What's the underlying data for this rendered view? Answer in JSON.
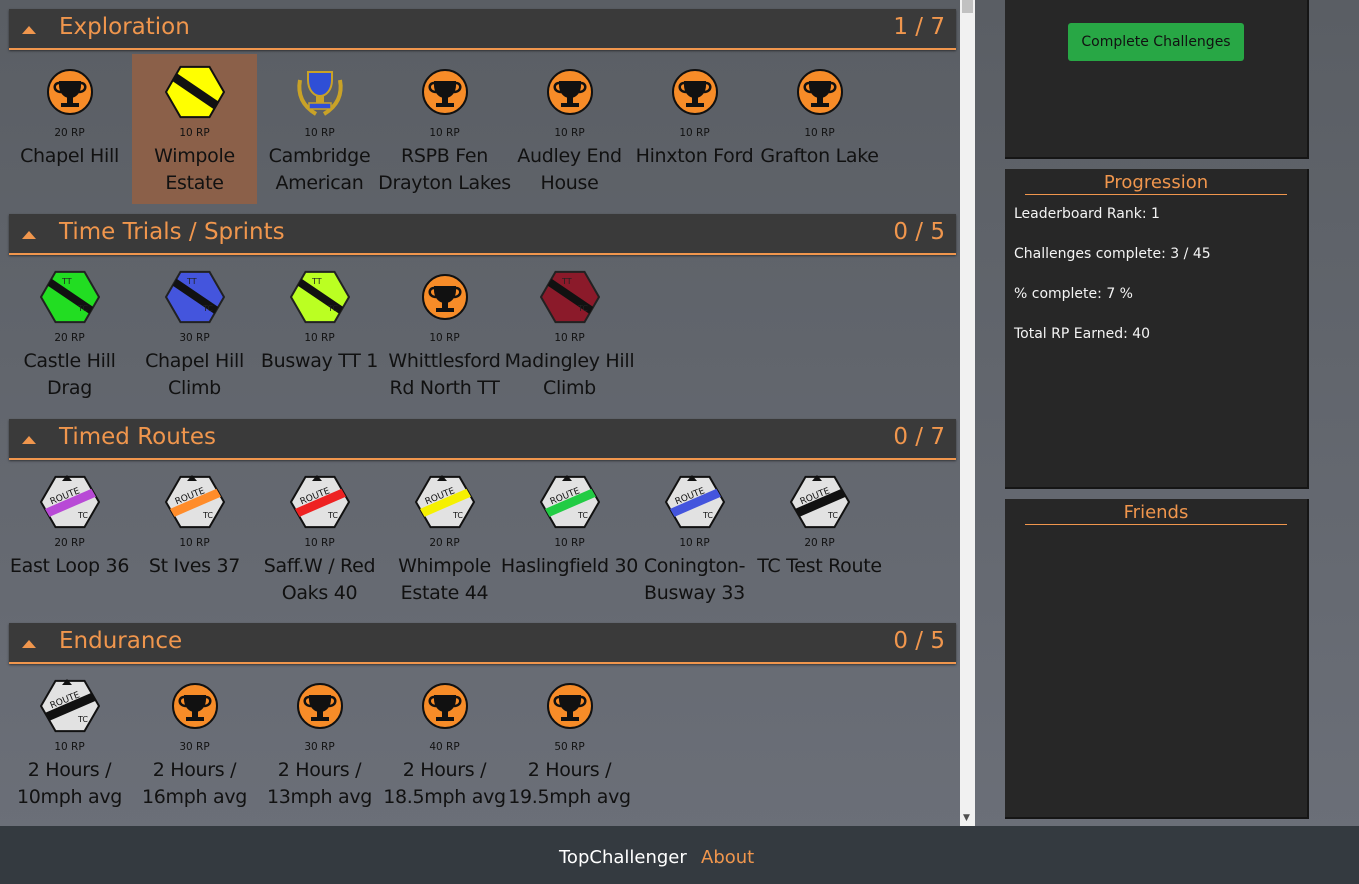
{
  "colors": {
    "accent": "#f0964d",
    "trophy_orange": "#f78c28",
    "button_green": "#28a745",
    "panel_bg": "#272727",
    "header_bg": "#3a3a3a",
    "footer_bg": "#343a40"
  },
  "sections": [
    {
      "title": "Exploration",
      "count": "1 / 7",
      "items": [
        {
          "icon": "trophy-icon",
          "rp": "20 RP",
          "name": "Chapel Hill"
        },
        {
          "icon": "hex-badge-icon",
          "color": "#ffff00",
          "rp": "10 RP",
          "name": "Wimpole Estate",
          "selected": true
        },
        {
          "icon": "gold-trophy-icon",
          "rp": "10 RP",
          "name": "Cambridge American"
        },
        {
          "icon": "trophy-icon",
          "rp": "10 RP",
          "name": "RSPB Fen Drayton Lakes"
        },
        {
          "icon": "trophy-icon",
          "rp": "10 RP",
          "name": "Audley End House"
        },
        {
          "icon": "trophy-icon",
          "rp": "10 RP",
          "name": "Hinxton Ford"
        },
        {
          "icon": "trophy-icon",
          "rp": "10 RP",
          "name": "Grafton Lake"
        }
      ]
    },
    {
      "title": "Time Trials / Sprints",
      "count": "0 / 5",
      "items": [
        {
          "icon": "tt-badge-icon",
          "color": "#22dd22",
          "rp": "20 RP",
          "name": "Castle Hill Drag"
        },
        {
          "icon": "tt-badge-icon",
          "color": "#4455dd",
          "rp": "30 RP",
          "name": "Chapel Hill Climb"
        },
        {
          "icon": "tt-badge-icon",
          "color": "#bbff22",
          "rp": "10 RP",
          "name": "Busway TT 1"
        },
        {
          "icon": "trophy-icon",
          "rp": "10 RP",
          "name": "Whittlesford Rd North TT"
        },
        {
          "icon": "tt-badge-icon",
          "color": "#8b1a2a",
          "rp": "10 RP",
          "name": "Madingley Hill Climb"
        }
      ]
    },
    {
      "title": "Timed Routes",
      "count": "0 / 7",
      "items": [
        {
          "icon": "route-badge-icon",
          "color": "#b84ad6",
          "rp": "20 RP",
          "name": "East Loop 36"
        },
        {
          "icon": "route-badge-icon",
          "color": "#ff8c2a",
          "rp": "10 RP",
          "name": "St Ives 37"
        },
        {
          "icon": "route-badge-icon",
          "color": "#ee2222",
          "rp": "10 RP",
          "name": "Saff.W / Red Oaks 40"
        },
        {
          "icon": "route-badge-icon",
          "color": "#f5f000",
          "rp": "20 RP",
          "name": "Whimpole Estate 44"
        },
        {
          "icon": "route-badge-icon",
          "color": "#22cc44",
          "rp": "10 RP",
          "name": "Haslingfield 30"
        },
        {
          "icon": "route-badge-icon",
          "color": "#4455dd",
          "rp": "10 RP",
          "name": "Conington-Busway 33"
        },
        {
          "icon": "route-badge-icon",
          "color": "#111111",
          "rp": "20 RP",
          "name": "TC Test Route"
        }
      ]
    },
    {
      "title": "Endurance",
      "count": "0 / 5",
      "items": [
        {
          "icon": "route-badge-icon",
          "color": "#111111",
          "rp": "10 RP",
          "name": "2 Hours / 10mph avg"
        },
        {
          "icon": "trophy-icon",
          "rp": "30 RP",
          "name": "2 Hours / 16mph avg"
        },
        {
          "icon": "trophy-icon",
          "rp": "30 RP",
          "name": "2 Hours / 13mph avg"
        },
        {
          "icon": "trophy-icon",
          "rp": "40 RP",
          "name": "2 Hours / 18.5mph avg"
        },
        {
          "icon": "trophy-icon",
          "rp": "50 RP",
          "name": "2 Hours / 19.5mph avg"
        }
      ]
    }
  ],
  "sidebar": {
    "complete_button": "Complete Challenges",
    "progression": {
      "title": "Progression",
      "rank": "Leaderboard Rank: 1",
      "complete": "Challenges complete: 3 / 45",
      "percent": "% complete: 7 %",
      "rp_total": "Total RP Earned: 40"
    },
    "friends": {
      "title": "Friends"
    }
  },
  "footer": {
    "brand": "TopChallenger",
    "about": "About"
  }
}
